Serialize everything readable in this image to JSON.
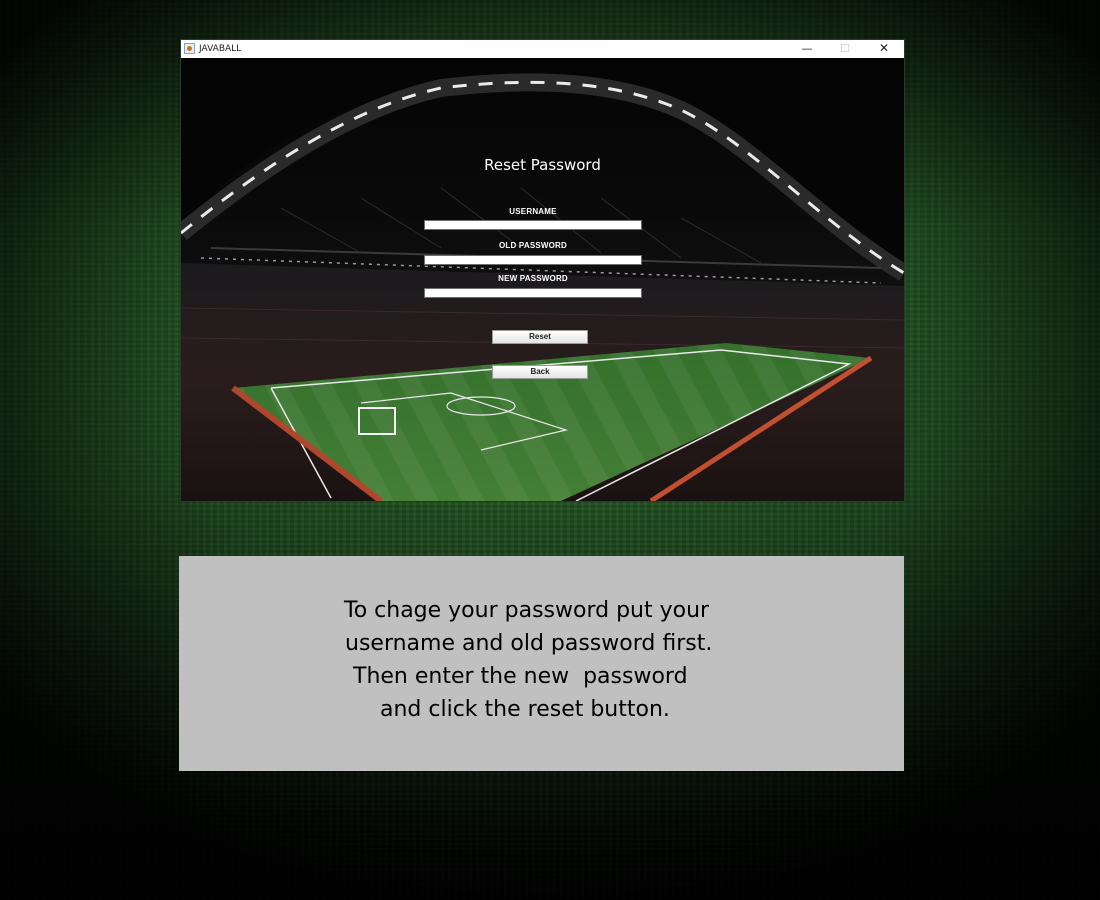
{
  "window": {
    "title": "JAVABALL",
    "controls": {
      "minimize": "—",
      "maximize": "☐",
      "close": "✕"
    }
  },
  "form": {
    "title": "Reset Password",
    "username": {
      "label": "USERNAME",
      "value": ""
    },
    "old_password": {
      "label": "OLD PASSWORD",
      "value": ""
    },
    "new_password": {
      "label": "NEW PASSWORD",
      "value": ""
    },
    "reset_label": "Reset",
    "back_label": "Back"
  },
  "instructions": {
    "lines": [
      "To chage your password put your",
      "username and old password first.",
      "Then enter the new  password",
      "and click the reset button."
    ]
  },
  "colors": {
    "panel_bg": "#c0c0c0",
    "pitch_green": "#3f7a32"
  }
}
